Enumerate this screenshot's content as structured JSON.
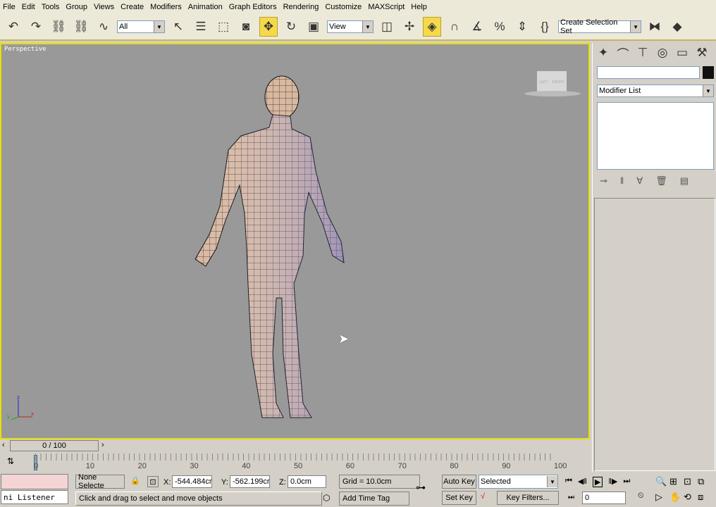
{
  "menu": [
    "File",
    "Edit",
    "Tools",
    "Group",
    "Views",
    "Create",
    "Modifiers",
    "Animation",
    "Graph Editors",
    "Rendering",
    "Customize",
    "MAXScript",
    "Help"
  ],
  "toolbar": {
    "filter_value": "All",
    "coord_value": "View",
    "selection_set_placeholder": "Create Selection Set"
  },
  "viewport": {
    "label": "Perspective",
    "viewcube_left": "LEFT",
    "viewcube_front": "FRONT",
    "axis_x": "x",
    "axis_y": "y",
    "axis_z": "z",
    "colors": {
      "background": "#999999",
      "border": "#e6e000",
      "mesh": "#d9b8a0"
    }
  },
  "command_panel": {
    "name_value": "",
    "modifier_list": "Modifier List"
  },
  "timeline": {
    "frame_display": "0 / 100",
    "ticks": [
      "0",
      "10",
      "20",
      "30",
      "40",
      "50",
      "60",
      "70",
      "80",
      "90",
      "100"
    ]
  },
  "status": {
    "listener": "ni Listener",
    "selection": "None Selecte",
    "x_label": "X:",
    "x_value": "-544.484cr",
    "y_label": "Y:",
    "y_value": "-562.199cr",
    "z_label": "Z:",
    "z_value": "0.0cm",
    "grid": "Grid = 10.0cm",
    "prompt": "Click and drag to select and move objects",
    "add_time_tag": "Add Time Tag",
    "auto_key": "Auto Key",
    "set_key": "Set Key",
    "key_mode": "Selected",
    "key_filters": "Key Filters...",
    "current_frame": "0"
  }
}
